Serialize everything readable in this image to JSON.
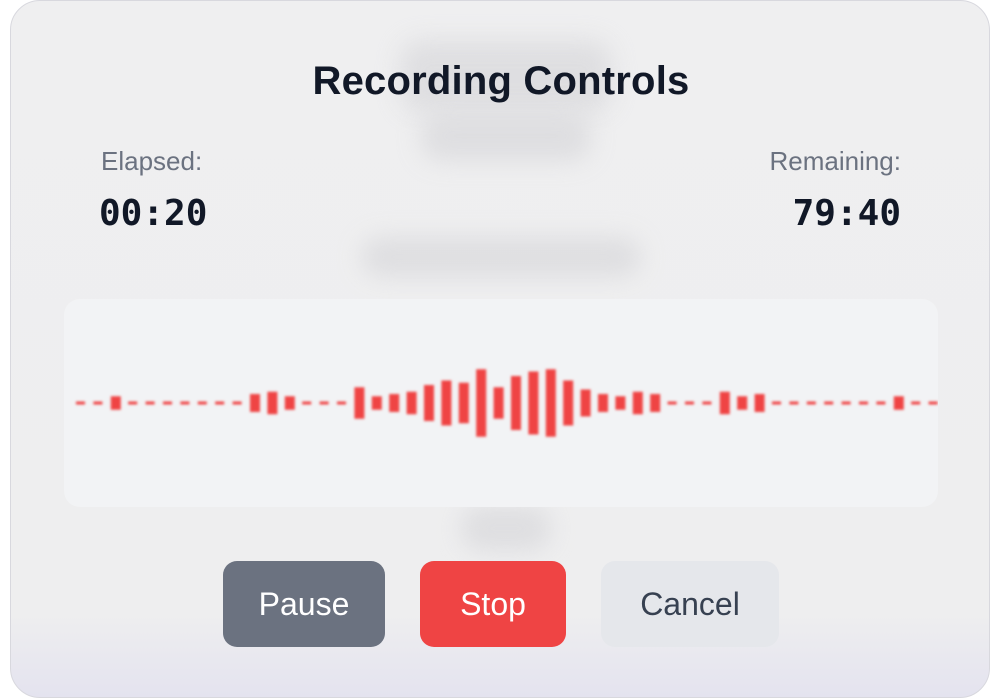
{
  "dialog": {
    "title": "Recording Controls",
    "elapsed_label": "Elapsed:",
    "elapsed_value": "00:20",
    "remaining_label": "Remaining:",
    "remaining_value": "79:40"
  },
  "waveform": {
    "color": "#ef4444",
    "levels": [
      0,
      0,
      0.3,
      0,
      0,
      0,
      0,
      0,
      0,
      0,
      0.4,
      0.5,
      0.3,
      0,
      0,
      0,
      0.7,
      0.3,
      0.4,
      0.5,
      0.8,
      1.0,
      0.9,
      1.5,
      0.7,
      1.2,
      1.4,
      1.5,
      1.0,
      0.6,
      0.4,
      0.3,
      0.5,
      0.4,
      0,
      0,
      0,
      0.5,
      0.3,
      0.4,
      0,
      0,
      0,
      0,
      0,
      0,
      0,
      0.3,
      0,
      0,
      0
    ]
  },
  "buttons": {
    "pause_label": "Pause",
    "stop_label": "Stop",
    "cancel_label": "Cancel"
  },
  "colors": {
    "pause": "#6b7280",
    "stop": "#ef4444",
    "cancel": "#e5e7eb",
    "title": "#111827",
    "label": "#6b7280"
  }
}
